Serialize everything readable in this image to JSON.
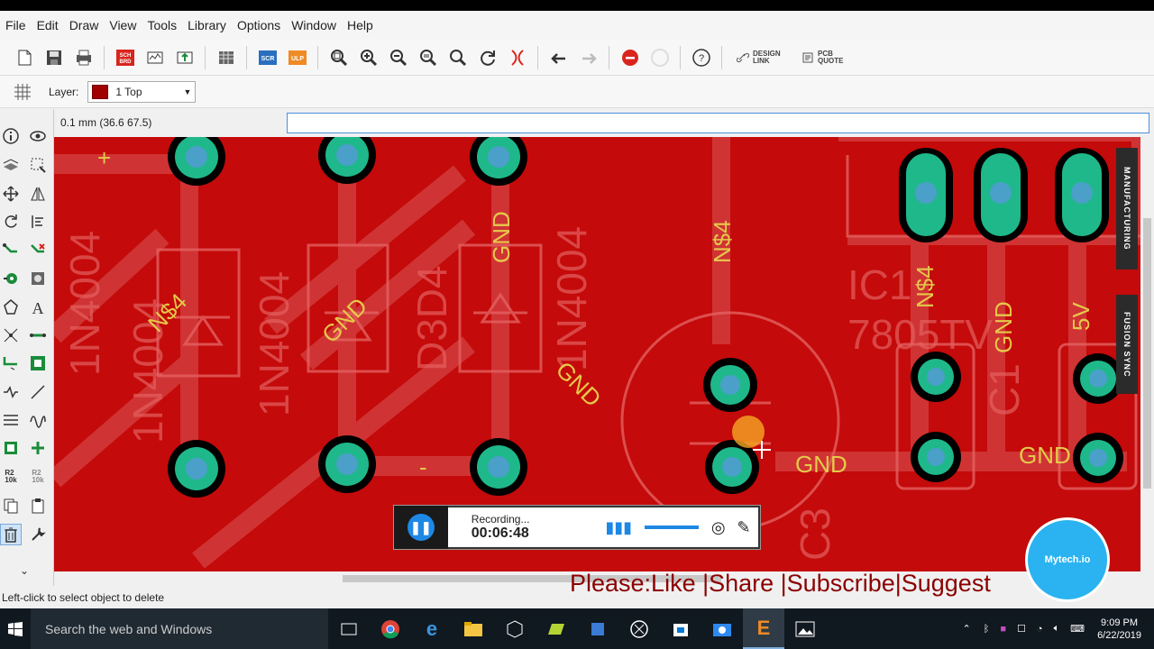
{
  "menu": [
    "File",
    "Edit",
    "Draw",
    "View",
    "Tools",
    "Library",
    "Options",
    "Window",
    "Help"
  ],
  "toolbar": {
    "sch_brd": "SCH BRD",
    "scr": "SCR",
    "ulp": "ULP",
    "design_link": "DESIGN LINK",
    "pcb_quote": "PCB QUOTE",
    "help": "?"
  },
  "layer": {
    "label": "Layer:",
    "value": "1 Top",
    "color": "#a00000"
  },
  "coord": {
    "text": "0.1 mm (36.6 67.5)",
    "command_value": ""
  },
  "left_tools_text": {
    "r2_10k": "R2\n10k"
  },
  "board": {
    "labels": {
      "n4_a": "N$4",
      "gnd_a": "GND",
      "gnd_b": "GND",
      "gnd_c": "GND",
      "n4_b": "N$4",
      "n4_c": "N$4",
      "gnd_d": "GND",
      "v5": "5V",
      "gnd_e": "GND",
      "gnd_f": "GND",
      "in1": "1N4004",
      "in2": "1N4004",
      "in3": "1N4004",
      "in4": "1N4004",
      "d3d4": "D3D4",
      "ic1": "IC1",
      "reg": "7805TV",
      "c1": "C1",
      "c3": "C3",
      "plus": "+",
      "minus": "-"
    },
    "side_tabs": {
      "manufacturing": "MANUFACTURING",
      "fusion_sync": "FUSION SYNC"
    }
  },
  "recorder": {
    "status": "Recording...",
    "time": "00:06:48"
  },
  "promo": "Please:Like |Share |Subscribe|Suggest",
  "logo": "Mytech.io",
  "status": "Left-click to select object to delete",
  "taskbar": {
    "search_placeholder": "Search the web and Windows",
    "time": "9:09 PM",
    "date": "6/22/2019"
  },
  "colors": {
    "board": "#c40a0a",
    "pad": "#1fb88a",
    "label": "#e6c84a",
    "silkscreen": "#d9534f"
  }
}
